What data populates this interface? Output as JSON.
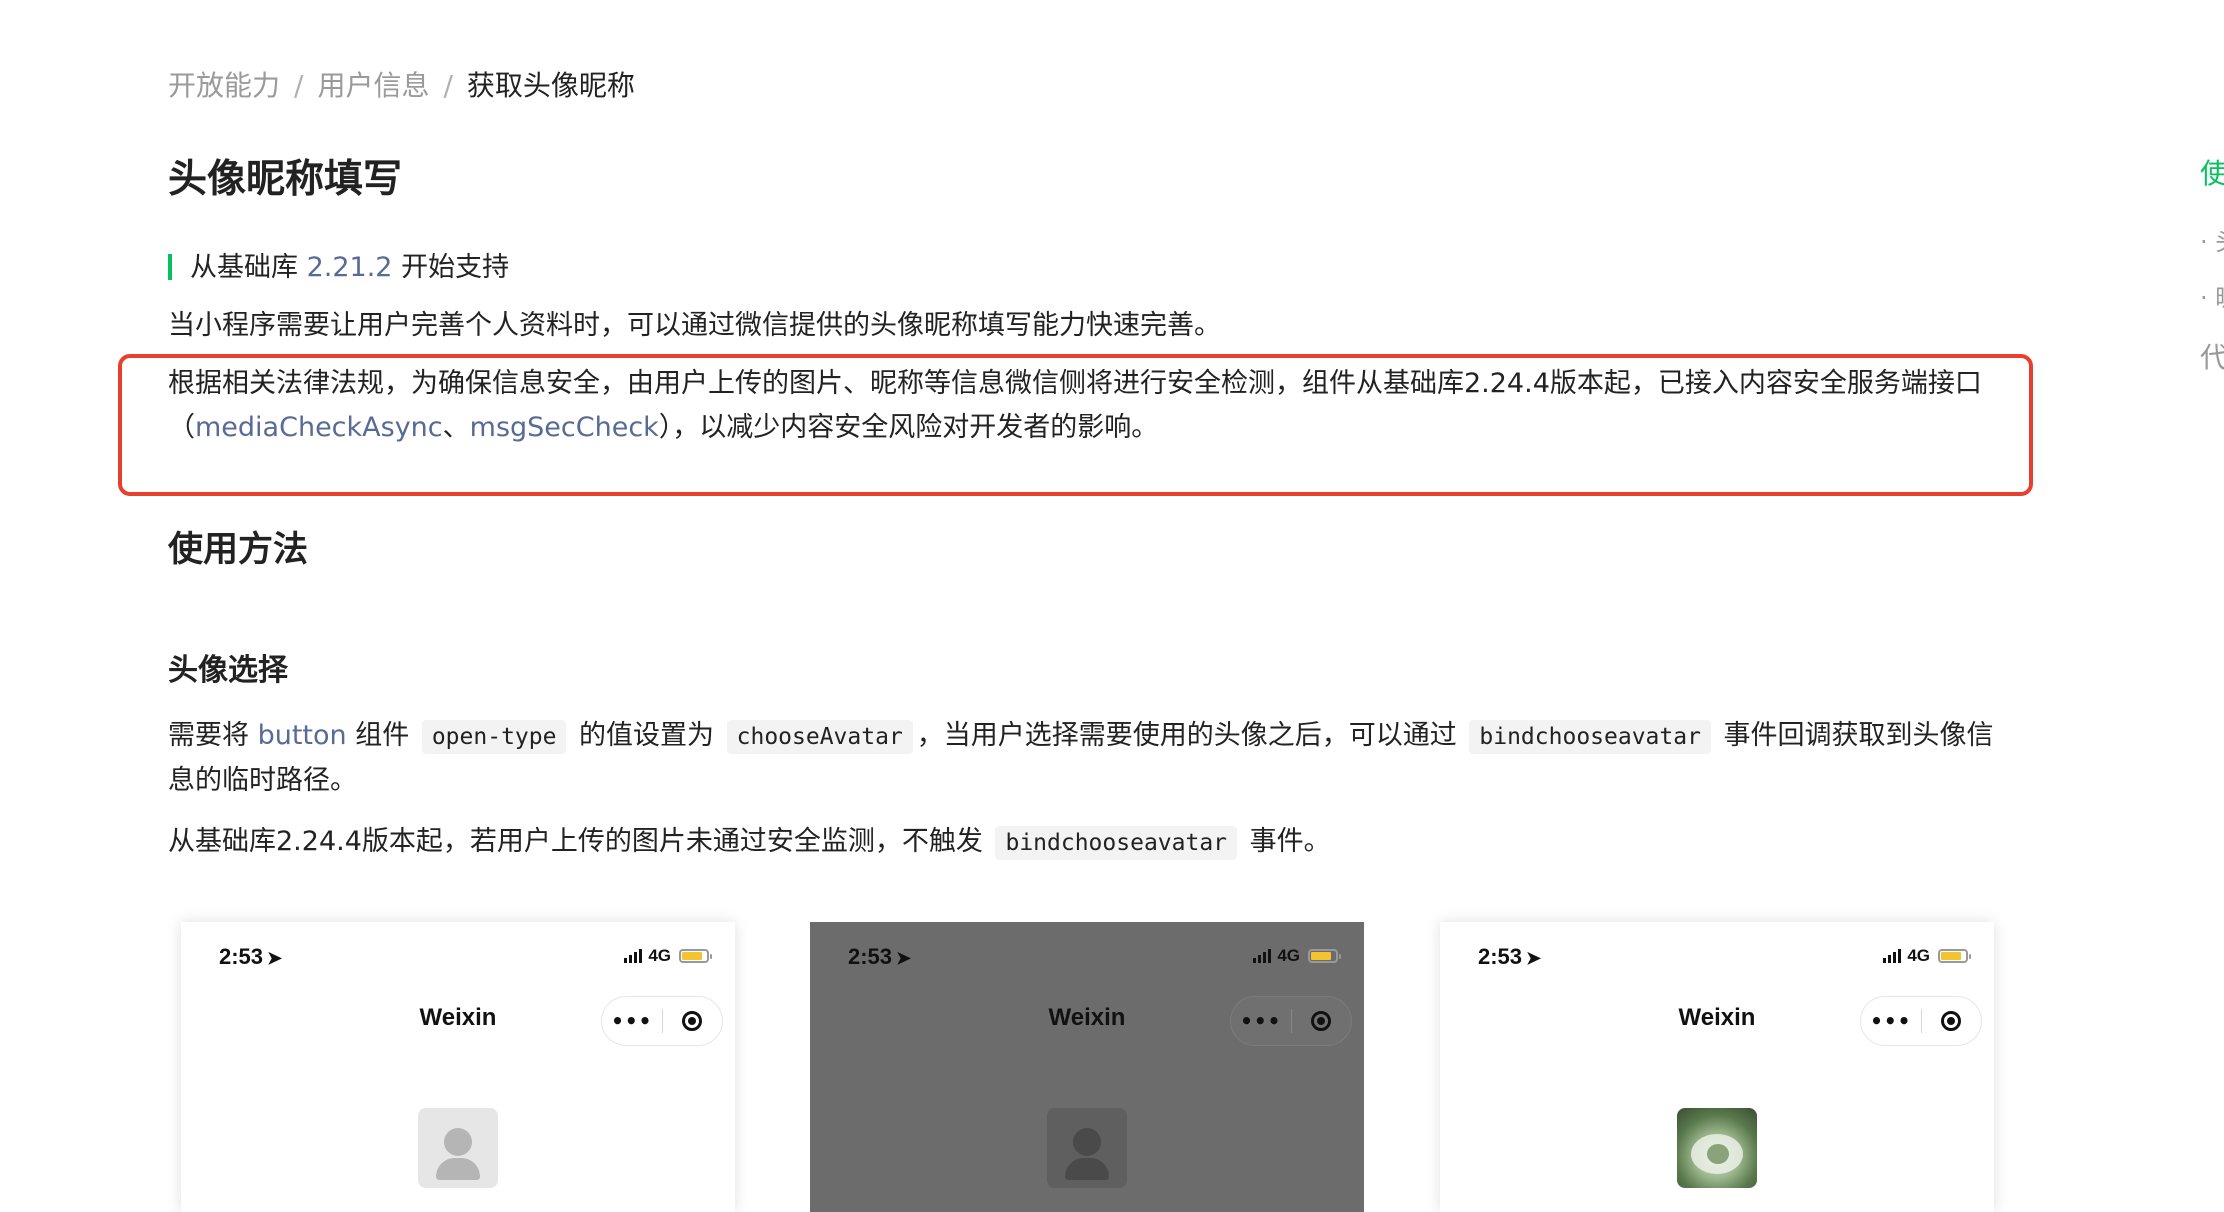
{
  "breadcrumb": {
    "items": [
      "开放能力",
      "用户信息"
    ],
    "separator": "/",
    "current": "获取头像昵称"
  },
  "page_title": "头像昵称填写",
  "since_note": {
    "prefix": "从基础库 ",
    "version": "2.21.2",
    "suffix": " 开始支持"
  },
  "intro": "当小程序需要让用户完善个人资料时，可以通过微信提供的头像昵称填写能力快速完善。",
  "security": {
    "text1": "根据相关法律法规，为确保信息安全，由用户上传的图片、昵称等信息微信侧将进行安全检测，组件从基础库2.24.4版本起，已接入内容安全服务端接口（",
    "link1": "mediaCheckAsync",
    "sep": "、",
    "link2": "msgSecCheck",
    "text2": "），以减少内容安全风险对开发者的影响。"
  },
  "usage_heading": "使用方法",
  "avatar_heading": "头像选择",
  "avatar_para": {
    "t1": "需要将 ",
    "link": "button",
    "t2": " 组件 ",
    "code1": "open-type",
    "t3": " 的值设置为 ",
    "code2": "chooseAvatar",
    "t4": "，当用户选择需要使用的头像之后，可以通过 ",
    "code3": "bindchooseavatar",
    "t5": " 事件回调获取到头像信息的临时路径。"
  },
  "avatar_note": {
    "t1": "从基础库2.24.4版本起，若用户上传的图片未通过安全监测，不触发 ",
    "code": "bindchooseavatar",
    "t2": " 事件。"
  },
  "toc": {
    "active": "使",
    "items": [
      "· 头",
      "· 昵",
      "代"
    ]
  },
  "phones": [
    {
      "time": "2:53",
      "network": "4G",
      "title": "Weixin",
      "more": "•••"
    },
    {
      "time": "2:53",
      "network": "4G",
      "title": "Weixin",
      "more": "•••"
    },
    {
      "time": "2:53",
      "network": "4G",
      "title": "Weixin",
      "more": "•••"
    }
  ],
  "colors": {
    "accent_green": "#07c160",
    "link_blue": "#576b95",
    "highlight_red": "#e8402f"
  }
}
